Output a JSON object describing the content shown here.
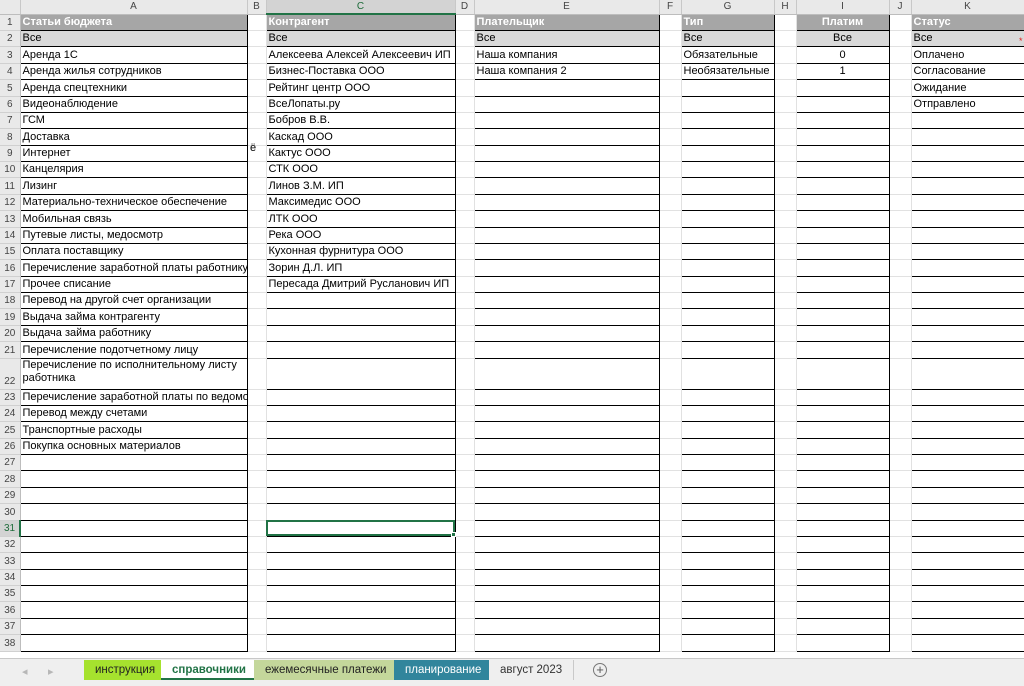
{
  "columns": [
    "A",
    "B",
    "C",
    "D",
    "E",
    "F",
    "G",
    "H",
    "I",
    "J",
    "K"
  ],
  "headers": {
    "A": "Статьи бюджета",
    "C": "Контрагент",
    "E": "Плательщик",
    "G": "Тип",
    "I": "Платим",
    "K": "Статус"
  },
  "all_label": "Все",
  "budget_items": [
    "Аренда 1С",
    "Аренда жилья сотрудников",
    "Аренда спецтехники",
    "Видеонаблюдение",
    "ГСМ",
    "Доставка",
    "Интернет",
    "Канцелярия",
    "Лизинг",
    "Материально-техническое обеспечение",
    "Мобильная связь",
    "Путевые листы, медосмотр",
    "Оплата поставщику",
    "Перечисление заработной платы работнику",
    "Прочее списание",
    "Перевод на другой счет организации",
    "Выдача займа контрагенту",
    "Выдача займа работнику",
    "Перечисление подотчетному лицу",
    "Перечисление по исполнительному листу работника",
    "Перечисление заработной платы по ведомостям",
    "Перевод между счетами",
    "Транспортные расходы",
    "Покупка основных материалов"
  ],
  "counterparties": [
    "Алексеева Алексей Алексеевич ИП",
    "Бизнес-Поставка ООО",
    "Рейтинг центр ООО",
    "ВсеЛопаты.ру",
    "Бобров В.В.",
    "Каскад ООО",
    "Кактус ООО",
    "СТК ООО",
    "Линов З.М. ИП",
    "Максимедис ООО",
    "ЛТК ООО",
    "Река ООО",
    "Кухонная фурнитура ООО",
    "Зорин Д.Л. ИП",
    "Пересада Дмитрий Русланович ИП"
  ],
  "payers": [
    "Наша компания",
    "Наша компания 2"
  ],
  "types": [
    "Обязательные",
    "Необязательные"
  ],
  "pay_flags": [
    "0",
    "1"
  ],
  "statuses": [
    "Оплачено",
    "Согласование",
    "Ожидание",
    "Отправлено"
  ],
  "stray_cell_b8": "ё",
  "active_cell": "C31",
  "sheet_tabs": {
    "instr": "инструкция",
    "ref": "справочники",
    "month": "ежемесячные платежи",
    "plan": "планирование",
    "aug": "август 2023"
  },
  "nav": {
    "prev": "◂",
    "next": "▸",
    "add": "+"
  },
  "colors": {
    "header_bg": "#a6a6a6",
    "all_row_bg": "#d9d9d9",
    "excel_green": "#217346",
    "tab_instr": "#a6e22e",
    "tab_month": "#c4d79b",
    "tab_plan": "#31859c"
  }
}
